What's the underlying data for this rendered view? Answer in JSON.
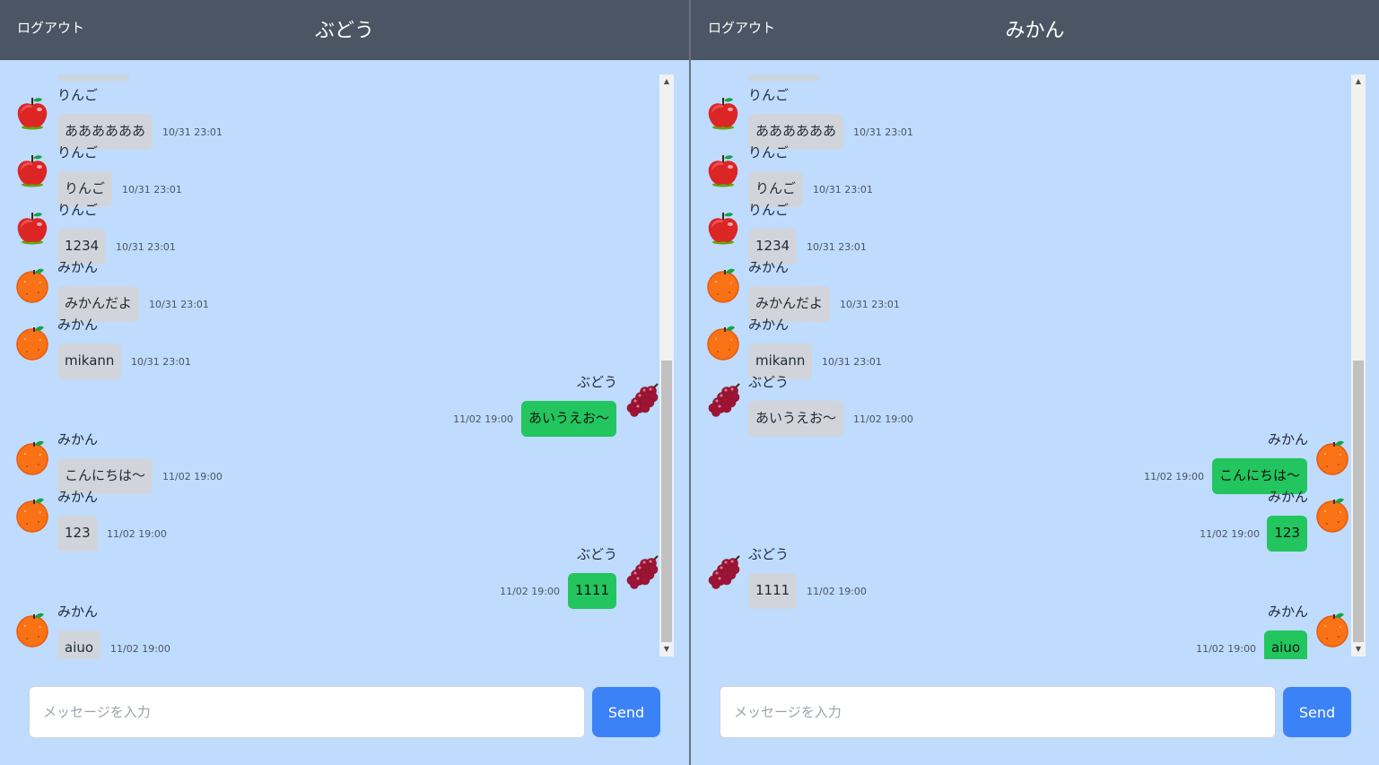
{
  "colors": {
    "header": "#4b5563",
    "background": "#bfdbfe",
    "bubble_other": "#d1d5db",
    "bubble_mine": "#22c55e",
    "send_button": "#3b82f6"
  },
  "panes": [
    {
      "logout_label": "ログアウト",
      "title": "ぶどう",
      "input_placeholder": "メッセージを入力",
      "send_label": "Send",
      "messages": [
        {
          "sender": "りんご",
          "icon": "apple-icon",
          "text": "ああああああ",
          "time": "10/31 23:01",
          "mine": false
        },
        {
          "sender": "りんご",
          "icon": "apple-icon",
          "text": "りんご",
          "time": "10/31 23:01",
          "mine": false
        },
        {
          "sender": "りんご",
          "icon": "apple-icon",
          "text": "1234",
          "time": "10/31 23:01",
          "mine": false
        },
        {
          "sender": "みかん",
          "icon": "orange-icon",
          "text": "みかんだよ",
          "time": "10/31 23:01",
          "mine": false
        },
        {
          "sender": "みかん",
          "icon": "orange-icon",
          "text": "mikann",
          "time": "10/31 23:01",
          "mine": false
        },
        {
          "sender": "ぶどう",
          "icon": "grape-icon",
          "text": "あいうえお〜",
          "time": "11/02 19:00",
          "mine": true
        },
        {
          "sender": "みかん",
          "icon": "orange-icon",
          "text": "こんにちは〜",
          "time": "11/02 19:00",
          "mine": false
        },
        {
          "sender": "みかん",
          "icon": "orange-icon",
          "text": "123",
          "time": "11/02 19:00",
          "mine": false
        },
        {
          "sender": "ぶどう",
          "icon": "grape-icon",
          "text": "1111",
          "time": "11/02 19:00",
          "mine": true
        },
        {
          "sender": "みかん",
          "icon": "orange-icon",
          "text": "aiuo",
          "time": "11/02 19:00",
          "mine": false
        }
      ]
    },
    {
      "logout_label": "ログアウト",
      "title": "みかん",
      "input_placeholder": "メッセージを入力",
      "send_label": "Send",
      "messages": [
        {
          "sender": "りんご",
          "icon": "apple-icon",
          "text": "ああああああ",
          "time": "10/31 23:01",
          "mine": false
        },
        {
          "sender": "りんご",
          "icon": "apple-icon",
          "text": "りんご",
          "time": "10/31 23:01",
          "mine": false
        },
        {
          "sender": "りんご",
          "icon": "apple-icon",
          "text": "1234",
          "time": "10/31 23:01",
          "mine": false
        },
        {
          "sender": "みかん",
          "icon": "orange-icon",
          "text": "みかんだよ",
          "time": "10/31 23:01",
          "mine": false
        },
        {
          "sender": "みかん",
          "icon": "orange-icon",
          "text": "mikann",
          "time": "10/31 23:01",
          "mine": false
        },
        {
          "sender": "ぶどう",
          "icon": "grape-icon",
          "text": "あいうえお〜",
          "time": "11/02 19:00",
          "mine": false
        },
        {
          "sender": "みかん",
          "icon": "orange-icon",
          "text": "こんにちは〜",
          "time": "11/02 19:00",
          "mine": true
        },
        {
          "sender": "みかん",
          "icon": "orange-icon",
          "text": "123",
          "time": "11/02 19:00",
          "mine": true
        },
        {
          "sender": "ぶどう",
          "icon": "grape-icon",
          "text": "1111",
          "time": "11/02 19:00",
          "mine": false
        },
        {
          "sender": "みかん",
          "icon": "orange-icon",
          "text": "aiuo",
          "time": "11/02 19:00",
          "mine": true
        }
      ]
    }
  ]
}
